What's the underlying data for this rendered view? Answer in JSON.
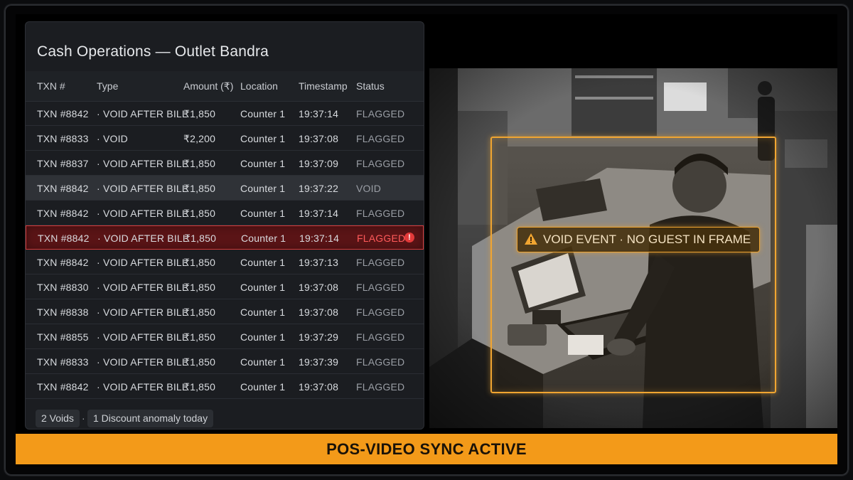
{
  "panel": {
    "title": "Cash Operations — Outlet Bandra",
    "columns": [
      "TXN #",
      "Type",
      "Amount (₹)",
      "Location",
      "Timestamp",
      "Status"
    ],
    "rows": [
      {
        "txn": "TXN #8842",
        "type": "· VOID AFTER BILL",
        "amount": "₹1,850",
        "location": "Counter 1",
        "timestamp": "19:37:14",
        "status": "FLAGGED"
      },
      {
        "txn": "TXN #8833",
        "type": "· VOID",
        "amount": "₹2,200",
        "location": "Counter 1",
        "timestamp": "19:37:08",
        "status": "FLAGGED"
      },
      {
        "txn": "TXN #8837",
        "type": "· VOID AFTER BILL",
        "amount": "₹1,850",
        "location": "Counter 1",
        "timestamp": "19:37:09",
        "status": "FLAGGED"
      },
      {
        "txn": "TXN #8842",
        "type": "· VOID AFTER BILL",
        "amount": "₹1,850",
        "location": "Counter 1",
        "timestamp": "19:37:22",
        "status": "VOID"
      },
      {
        "txn": "TXN #8842",
        "type": "· VOID AFTER BILL",
        "amount": "₹1,850",
        "location": "Counter 1",
        "timestamp": "19:37:14",
        "status": "FLAGGED"
      },
      {
        "txn": "TXN #8842",
        "type": "· VOID AFTER BILL",
        "amount": "₹1,850",
        "location": "Counter 1",
        "timestamp": "19:37:14",
        "status": "FLAGGED"
      },
      {
        "txn": "TXN #8842",
        "type": "· VOID AFTER BILL",
        "amount": "₹1,850",
        "location": "Counter 1",
        "timestamp": "19:37:13",
        "status": "FLAGGED"
      },
      {
        "txn": "TXN #8830",
        "type": "· VOID AFTER BILL",
        "amount": "₹1,850",
        "location": "Counter 1",
        "timestamp": "19:37:08",
        "status": "FLAGGED"
      },
      {
        "txn": "TXN #8838",
        "type": "· VOID AFTER BILL",
        "amount": "₹1,850",
        "location": "Counter 1",
        "timestamp": "19:37:08",
        "status": "FLAGGED"
      },
      {
        "txn": "TXN #8855",
        "type": "· VOID AFTER BILL",
        "amount": "₹1,850",
        "location": "Counter 1",
        "timestamp": "19:37:29",
        "status": "FLAGGED"
      },
      {
        "txn": "TXN #8833",
        "type": "· VOID AFTER BILL",
        "amount": "₹1,850",
        "location": "Counter 1",
        "timestamp": "19:37:39",
        "status": "FLAGGED"
      },
      {
        "txn": "TXN #8842",
        "type": "· VOID AFTER BILL",
        "amount": "₹1,850",
        "location": "Counter 1",
        "timestamp": "19:37:08",
        "status": "FLAGGED"
      }
    ],
    "selected_row_index": 3,
    "alert_row_index": 5,
    "alert_icon": "alert-circle-icon",
    "alert_icon_glyph": "!",
    "summary": {
      "voids": "2 Voids",
      "separator": "·",
      "anomaly": "1 Discount anomaly today"
    }
  },
  "camera": {
    "detection_label": "VOID EVENT · NO GUEST IN FRAME",
    "detection_icon": "warning-triangle-icon"
  },
  "banner": {
    "text": "POS-VIDEO SYNC ACTIVE"
  },
  "colors": {
    "accent_orange": "#f39a19",
    "alert_red": "#e23a3a",
    "detection_amber": "#f0a531"
  }
}
